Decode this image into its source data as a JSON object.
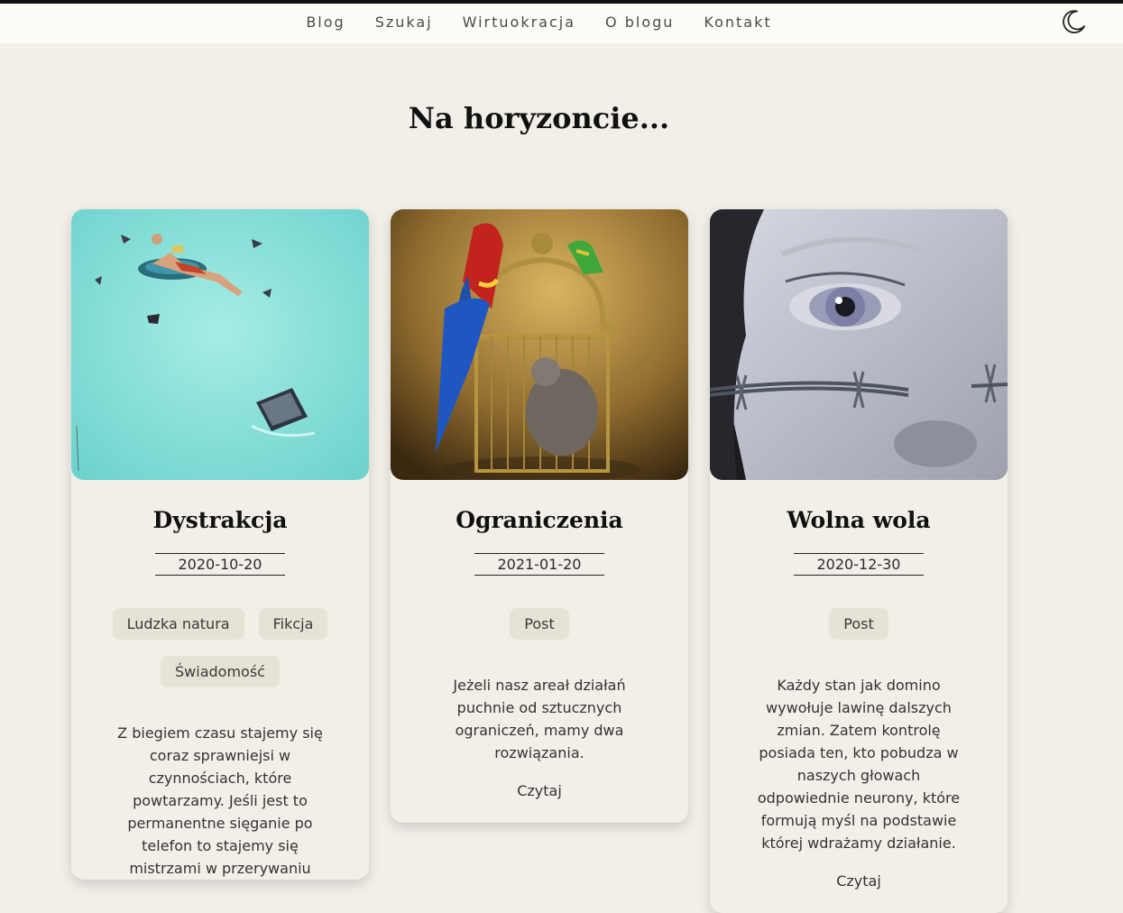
{
  "nav": {
    "links": [
      "Blog",
      "Szukaj",
      "Wirtuokracja",
      "O blogu",
      "Kontakt"
    ],
    "theme_icon": "moon-icon"
  },
  "page_title": "Na horyzoncie...",
  "posts": [
    {
      "title": "Dystrakcja",
      "date": "2020-10-20",
      "tags": [
        "Ludzka natura",
        "Fikcja",
        "Świadomość"
      ],
      "excerpt": "Z biegiem czasu stajemy się coraz sprawniejsi w czynnościach, które powtarzamy. Jeśli jest to permanentne sięganie po telefon to stajemy się mistrzami w przerywaniu",
      "image": "man-reading-on-float-illustration"
    },
    {
      "title": "Ograniczenia",
      "date": "2021-01-20",
      "tags": [
        "Post"
      ],
      "excerpt": "Jeżeli nasz areał działań puchnie od sztucznych ograniczeń, mamy dwa rozwiązania.",
      "read_more": "Czytaj",
      "image": "parrots-on-birdcage-with-cat"
    },
    {
      "title": "Wolna wola",
      "date": "2020-12-30",
      "tags": [
        "Post"
      ],
      "excerpt": "Każdy stan jak domino wywołuje lawinę dalszych zmian. Zatem kontrolę posiada ten, kto pobudza w naszych głowach odpowiednie neurony, które formują myśl na podstawie której wdrażamy działanie.",
      "read_more": "Czytaj",
      "image": "face-with-barbed-wire"
    }
  ],
  "colors": {
    "background": "#f2efe9",
    "navbar": "#fdfcf6",
    "tag_bg": "#e6e2d5",
    "top_border": "#111111"
  }
}
